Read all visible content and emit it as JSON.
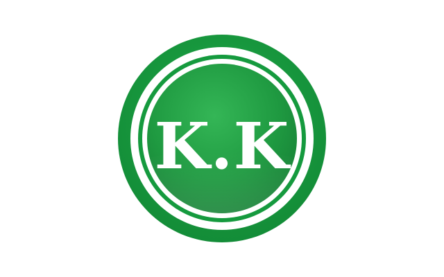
{
  "logo": {
    "text": "K.K",
    "colors": {
      "outer_ring": "#159a3e",
      "white_ring": "#ffffff",
      "inner_disc": "#1f9a41",
      "inner_disc_highlight": "#2fae4e",
      "text": "#ffffff"
    },
    "icon": "kk-badge-logo"
  }
}
